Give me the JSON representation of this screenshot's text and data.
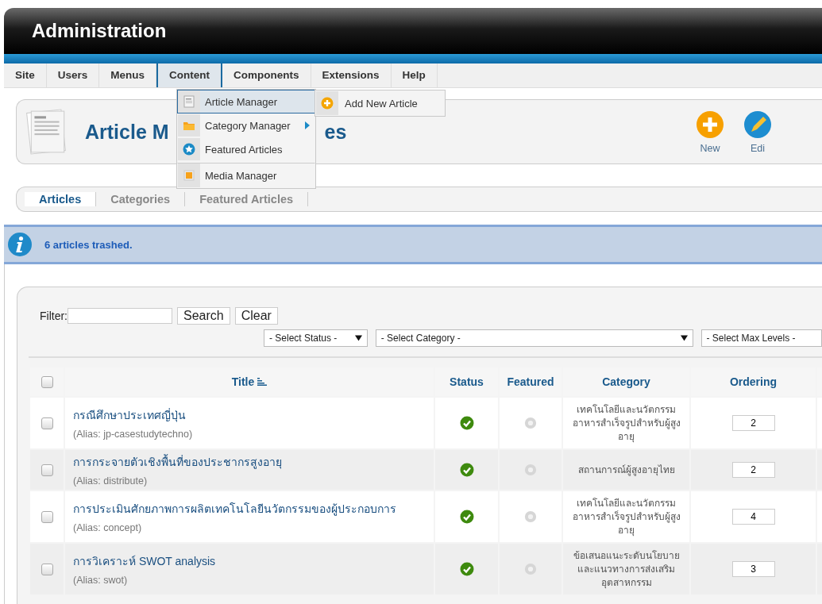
{
  "header": {
    "title": "Administration"
  },
  "menu_bar": [
    {
      "label": "Site",
      "selected": false
    },
    {
      "label": "Users",
      "selected": false
    },
    {
      "label": "Menus",
      "selected": false
    },
    {
      "label": "Content",
      "selected": true
    },
    {
      "label": "Components",
      "selected": false
    },
    {
      "label": "Extensions",
      "selected": false
    },
    {
      "label": "Help",
      "selected": false
    }
  ],
  "dropdown": {
    "items": [
      {
        "label": "Article Manager",
        "kind": "page",
        "selected": true,
        "has_submenu": false
      },
      {
        "label": "Category Manager",
        "kind": "folder",
        "selected": false,
        "has_submenu": true
      },
      {
        "label": "Featured Articles",
        "kind": "star",
        "selected": false,
        "has_submenu": false
      },
      {
        "label": "Media Manager",
        "kind": "media",
        "selected": false,
        "has_submenu": false,
        "divider_before": true
      }
    ],
    "submenu": [
      {
        "label": "Add New Article",
        "kind": "add"
      }
    ]
  },
  "toolbar": {
    "title_parts": [
      "Article M",
      "es"
    ],
    "buttons": [
      {
        "label": "New",
        "kind": "new"
      },
      {
        "label": "Edi",
        "kind": "edit"
      }
    ]
  },
  "subtabs": [
    {
      "label": "Articles",
      "selected": true
    },
    {
      "label": "Categories",
      "selected": false
    },
    {
      "label": "Featured Articles",
      "selected": false
    }
  ],
  "message": "6 articles trashed.",
  "filter": {
    "label": "Filter:",
    "buttons": [
      "Search",
      "Clear"
    ],
    "selects": [
      {
        "label": "- Select Status -",
        "kind": "short"
      },
      {
        "label": "- Select Category -",
        "kind": "wide"
      },
      {
        "label": "- Select Max Levels -",
        "kind": "cut"
      }
    ]
  },
  "table": {
    "all_checked": false,
    "columns": [
      "Title",
      "Status",
      "Featured",
      "Category",
      "Ordering"
    ],
    "rows": [
      {
        "checked": false,
        "title": "กรณีศึกษาประเทศญี่ปุ่น",
        "alias": "(Alias: jp-casestudytechno)",
        "published": true,
        "featured": false,
        "category": "เทคโนโลยีและนวัตกรรมอาหารสำเร็จรูปสำหรับผู้สูงอายุ",
        "ordering": "2"
      },
      {
        "checked": false,
        "title": "การกระจายตัวเชิงพื้นที่ของประชากรสูงอายุ",
        "alias": "(Alias: distribute)",
        "published": true,
        "featured": false,
        "category": "สถานการณ์ผู้สูงอายุไทย",
        "ordering": "2"
      },
      {
        "checked": false,
        "title": "การประเมินศักยภาพการผลิตเทคโนโลยีนวัตกรรมของผู้ประกอบการ",
        "alias": "(Alias: concept)",
        "published": true,
        "featured": false,
        "category": "เทคโนโลยีและนวัตกรรมอาหารสำเร็จรูปสำหรับผู้สูงอายุ",
        "ordering": "4"
      },
      {
        "checked": false,
        "title": "การวิเคราะห์ SWOT analysis",
        "alias": "(Alias: swot)",
        "published": true,
        "featured": false,
        "category": "ข้อเสนอแนะระดับนโยบายและแนวทางการส่งเสริมอุตสาหกรรม",
        "ordering": "3"
      }
    ]
  }
}
